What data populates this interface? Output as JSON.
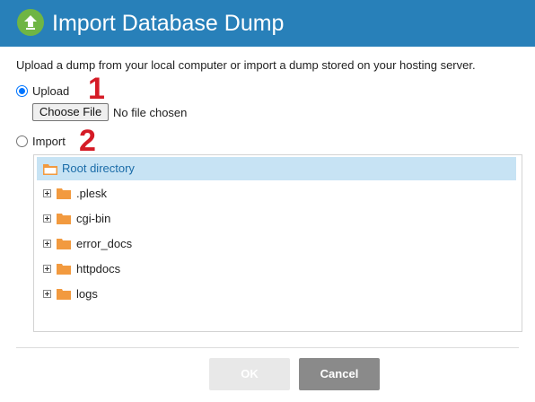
{
  "dialog": {
    "title": "Import Database Dump",
    "description": "Upload a dump from your local computer or import a dump stored on your hosting server."
  },
  "upload": {
    "label": "Upload",
    "selected": true,
    "choose_button": "Choose File",
    "file_status": "No file chosen",
    "marker": "1"
  },
  "import": {
    "label": "Import",
    "selected": false,
    "marker": "2"
  },
  "tree": {
    "root": "Root directory",
    "items": [
      {
        "label": ".plesk"
      },
      {
        "label": "cgi-bin"
      },
      {
        "label": "error_docs"
      },
      {
        "label": "httpdocs"
      },
      {
        "label": "logs"
      }
    ]
  },
  "footer": {
    "ok_label": "OK",
    "cancel_label": "Cancel"
  },
  "colors": {
    "header": "#2880b9",
    "logo": "#6fb544",
    "folder": "#f29a3f",
    "selection": "#c7e3f4",
    "marker": "#d51b26"
  }
}
